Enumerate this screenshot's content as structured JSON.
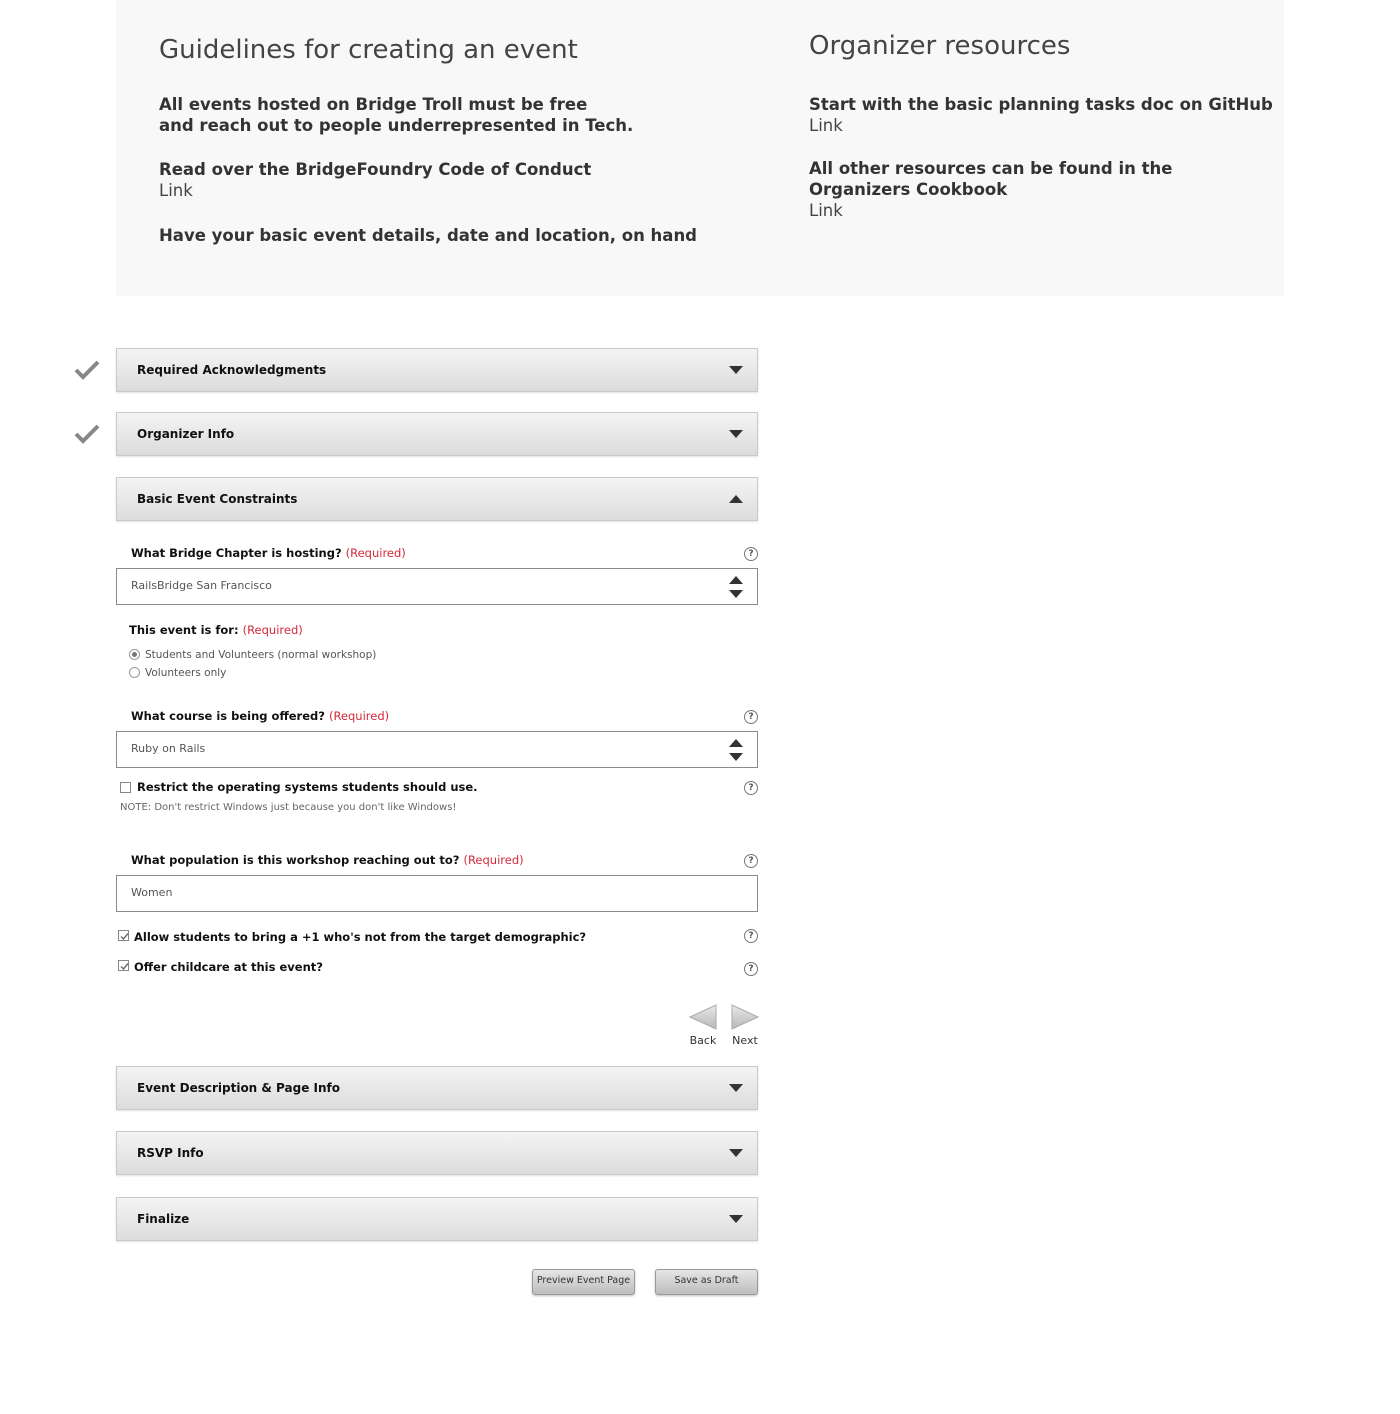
{
  "guidelines": {
    "title": "Guidelines for creating an event",
    "free_line1": "All events hosted on Bridge Troll must be free",
    "free_line2": "and reach out to people underrepresented in Tech.",
    "conduct": "Read over the BridgeFoundry Code of Conduct",
    "conduct_link": "Link",
    "details": "Have your basic event details, date and location, on hand"
  },
  "resources": {
    "title": "Organizer resources",
    "planning": "Start with the basic planning tasks doc on GitHub",
    "planning_link": "Link",
    "other_line1": "All other resources can be found in the",
    "other_line2": "Organizers Cookbook",
    "other_link": "Link"
  },
  "sections": {
    "acknowledgments": "Required Acknowledgments",
    "organizer": "Organizer Info",
    "constraints": "Basic Event Constraints",
    "description": "Event Description & Page Info",
    "rsvp": "RSVP Info",
    "finalize": "Finalize"
  },
  "form": {
    "required_text": "(Required)",
    "help_glyph": "?",
    "chapter_label": "What Bridge Chapter is hosting?",
    "chapter_value": "RailsBridge San Francisco",
    "event_for_label": "This event is for:",
    "event_for_options": [
      "Students and Volunteers (normal workshop)",
      "Volunteers only"
    ],
    "course_label": "What course is being offered?",
    "course_value": "Ruby on Rails",
    "restrict_os_label": "Restrict the operating systems students should use.",
    "restrict_os_note": "NOTE: Don't restrict Windows just because you don't like Windows!",
    "population_label": "What population is this workshop reaching out to?",
    "population_value": "Women",
    "plus_one_label": "Allow students to bring a +1 who's not from the target demographic?",
    "childcare_label": "Offer childcare at this event?"
  },
  "nav": {
    "back": "Back",
    "next": "Next"
  },
  "buttons": {
    "preview": "Preview Event Page",
    "draft": "Save as Draft"
  },
  "icons": [
    "check-icon",
    "caret-down-icon",
    "caret-up-icon",
    "help-icon",
    "spinner-icon",
    "arrow-left-icon",
    "arrow-right-icon"
  ]
}
